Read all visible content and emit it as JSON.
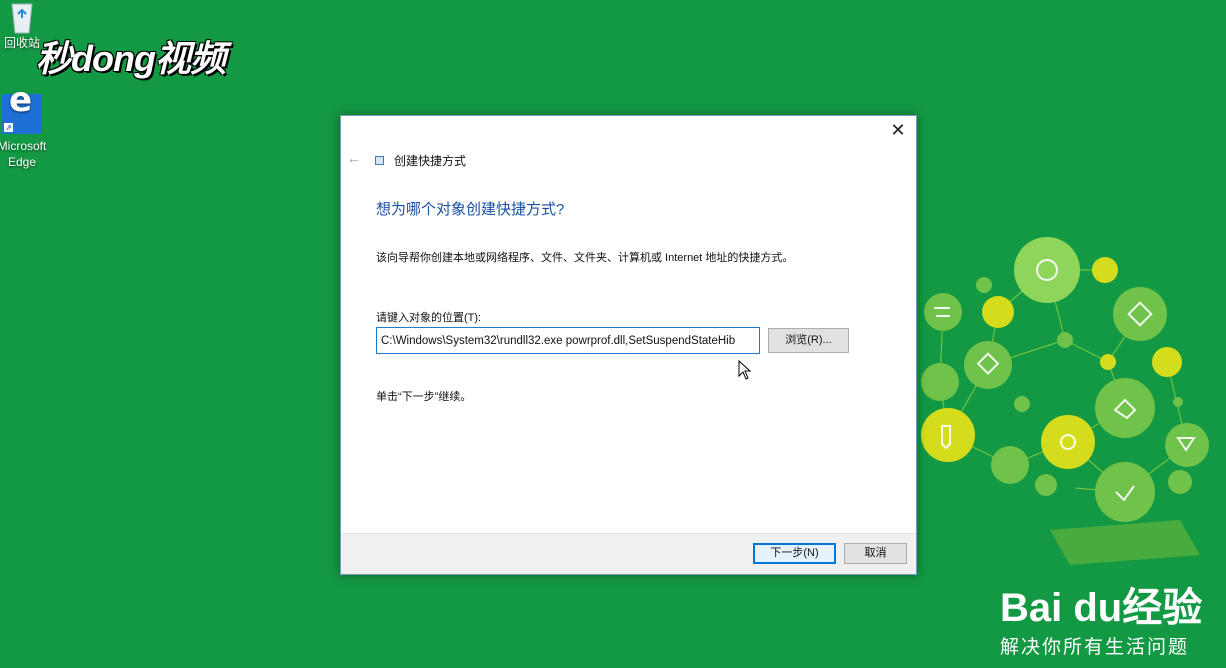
{
  "desktop": {
    "recycle_bin_label": "回收站",
    "edge_label_line1": "Microsoft",
    "edge_label_line2": "Edge",
    "watermark_top": "秒dong视频",
    "baidu_logo": "Bai du经验",
    "baidu_slogan": "解决你所有生活问题"
  },
  "dialog": {
    "wizard_title": "创建快捷方式",
    "heading": "想为哪个对象创建快捷方式?",
    "description": "该向导帮你创建本地或网络程序、文件、文件夹、计算机或 Internet 地址的快捷方式。",
    "location_label": "请键入对象的位置(T):",
    "location_value": "C:\\Windows\\System32\\rundll32.exe powrprof.dll,SetSuspendStateHib",
    "browse_label": "浏览(R)...",
    "hint": "单击“下一步”继续。",
    "next_label": "下一步(N)",
    "cancel_label": "取消",
    "close_glyph": "✕",
    "back_glyph": "←"
  },
  "colors": {
    "desktop_bg": "#139843",
    "accent": "#0078d7",
    "heading": "#1a4fa3"
  }
}
